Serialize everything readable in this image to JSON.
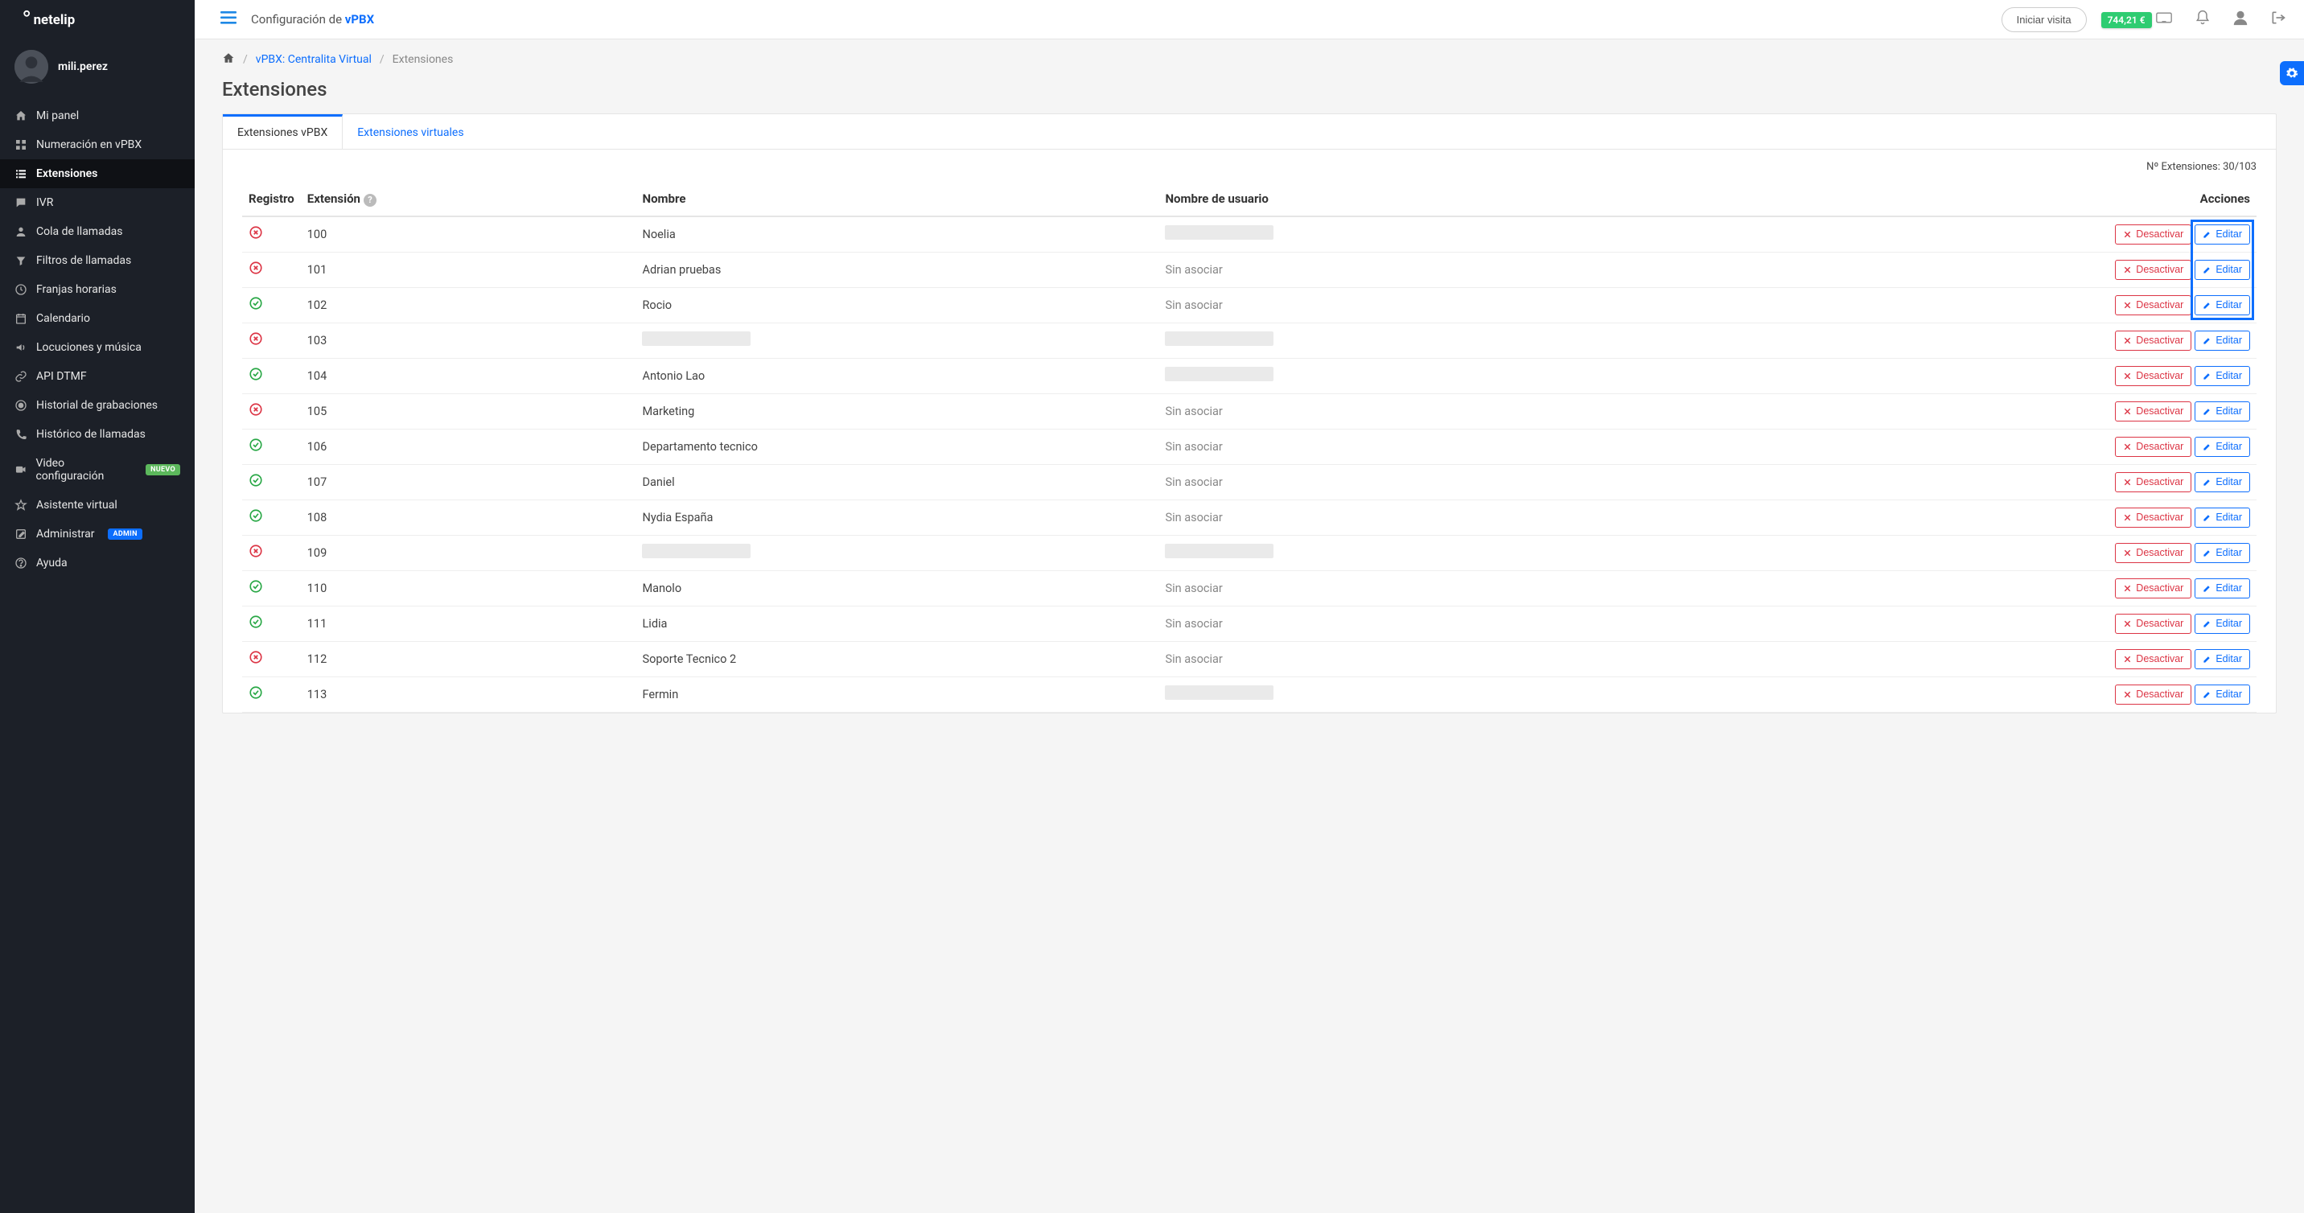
{
  "brand": "netelip",
  "user": {
    "name": "mili.perez"
  },
  "balance": "744,21 €",
  "topbar": {
    "title_prefix": "Configuración de ",
    "title_bold": "vPBX",
    "iniciar_visita": "Iniciar visita"
  },
  "sidebar": {
    "items": [
      {
        "label": "Mi panel",
        "icon": "home"
      },
      {
        "label": "Numeración en vPBX",
        "icon": "grid"
      },
      {
        "label": "Extensiones",
        "icon": "list",
        "active": true
      },
      {
        "label": "IVR",
        "icon": "chat"
      },
      {
        "label": "Cola de llamadas",
        "icon": "user"
      },
      {
        "label": "Filtros de llamadas",
        "icon": "filter"
      },
      {
        "label": "Franjas horarias",
        "icon": "clock"
      },
      {
        "label": "Calendario",
        "icon": "calendar"
      },
      {
        "label": "Locuciones y música",
        "icon": "volume"
      },
      {
        "label": "API DTMF",
        "icon": "link"
      },
      {
        "label": "Historial de grabaciones",
        "icon": "record"
      },
      {
        "label": "Histórico de llamadas",
        "icon": "phone"
      },
      {
        "label": "Video configuración",
        "icon": "video",
        "badge": "NUEVO"
      },
      {
        "label": "Asistente virtual",
        "icon": "star"
      },
      {
        "label": "Administrar",
        "icon": "edit-sq",
        "badge": "ADMIN"
      },
      {
        "label": "Ayuda",
        "icon": "help"
      }
    ]
  },
  "breadcrumb": {
    "vpbx": "vPBX: Centralita Virtual",
    "current": "Extensiones"
  },
  "page": {
    "title": "Extensiones"
  },
  "tabs": {
    "vpbx": "Extensiones vPBX",
    "virtual": "Extensiones virtuales"
  },
  "meta": {
    "count_label": "Nº Extensiones: 30/103"
  },
  "table": {
    "headers": {
      "registro": "Registro",
      "extension": "Extensión",
      "nombre": "Nombre",
      "usuario": "Nombre de usuario",
      "acciones": "Acciones"
    },
    "deactivate_label": "Desactivar",
    "edit_label": "Editar",
    "sin_asociar": "Sin asociar",
    "rows": [
      {
        "status": "fail",
        "ext": "100",
        "nombre": "Noelia",
        "usuario": ""
      },
      {
        "status": "fail",
        "ext": "101",
        "nombre": "Adrian pruebas",
        "usuario": "Sin asociar"
      },
      {
        "status": "ok",
        "ext": "102",
        "nombre": "Rocio",
        "usuario": "Sin asociar"
      },
      {
        "status": "fail",
        "ext": "103",
        "nombre": "",
        "usuario": ""
      },
      {
        "status": "ok",
        "ext": "104",
        "nombre": "Antonio Lao",
        "usuario": ""
      },
      {
        "status": "fail",
        "ext": "105",
        "nombre": "Marketing",
        "usuario": "Sin asociar"
      },
      {
        "status": "ok",
        "ext": "106",
        "nombre": "Departamento tecnico",
        "usuario": "Sin asociar"
      },
      {
        "status": "ok",
        "ext": "107",
        "nombre": "Daniel",
        "usuario": "Sin asociar"
      },
      {
        "status": "ok",
        "ext": "108",
        "nombre": "Nydia España",
        "usuario": "Sin asociar"
      },
      {
        "status": "fail",
        "ext": "109",
        "nombre": "",
        "usuario": ""
      },
      {
        "status": "ok",
        "ext": "110",
        "nombre": "Manolo",
        "usuario": "Sin asociar"
      },
      {
        "status": "ok",
        "ext": "111",
        "nombre": "Lidia",
        "usuario": "Sin asociar"
      },
      {
        "status": "fail",
        "ext": "112",
        "nombre": "Soporte Tecnico 2",
        "usuario": "Sin asociar"
      },
      {
        "status": "ok",
        "ext": "113",
        "nombre": "Fermin",
        "usuario": ""
      }
    ]
  },
  "highlight": {
    "first_n_rows": 3,
    "column": "edit"
  }
}
